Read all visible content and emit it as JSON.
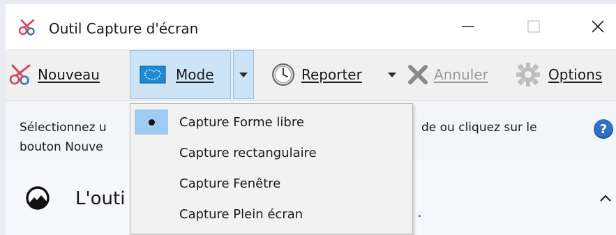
{
  "window": {
    "title": "Outil Capture d'écran"
  },
  "toolbar": {
    "new_label": "Nouveau",
    "mode_label": "Mode",
    "delay_label": "Reporter",
    "cancel_label": "Annuler",
    "options_label": "Options"
  },
  "info": {
    "line1_left": "Sélectionnez u",
    "line1_right": "de ou cliquez sur le",
    "line2_left": "bouton Nouve",
    "help_label": "?"
  },
  "notice": {
    "text": "L'outi",
    "dot": "."
  },
  "mode_menu": {
    "items": [
      {
        "label": "Capture Forme libre",
        "selected": true
      },
      {
        "label": "Capture rectangulaire",
        "selected": false
      },
      {
        "label": "Capture Fenêtre",
        "selected": false
      },
      {
        "label": "Capture Plein écran",
        "selected": false
      }
    ]
  },
  "colors": {
    "mode_highlight": "#cde4f7",
    "menu_selected": "#9ecbf2",
    "accent_blue": "#2f6fc7",
    "scissors_red": "#d8405a"
  }
}
